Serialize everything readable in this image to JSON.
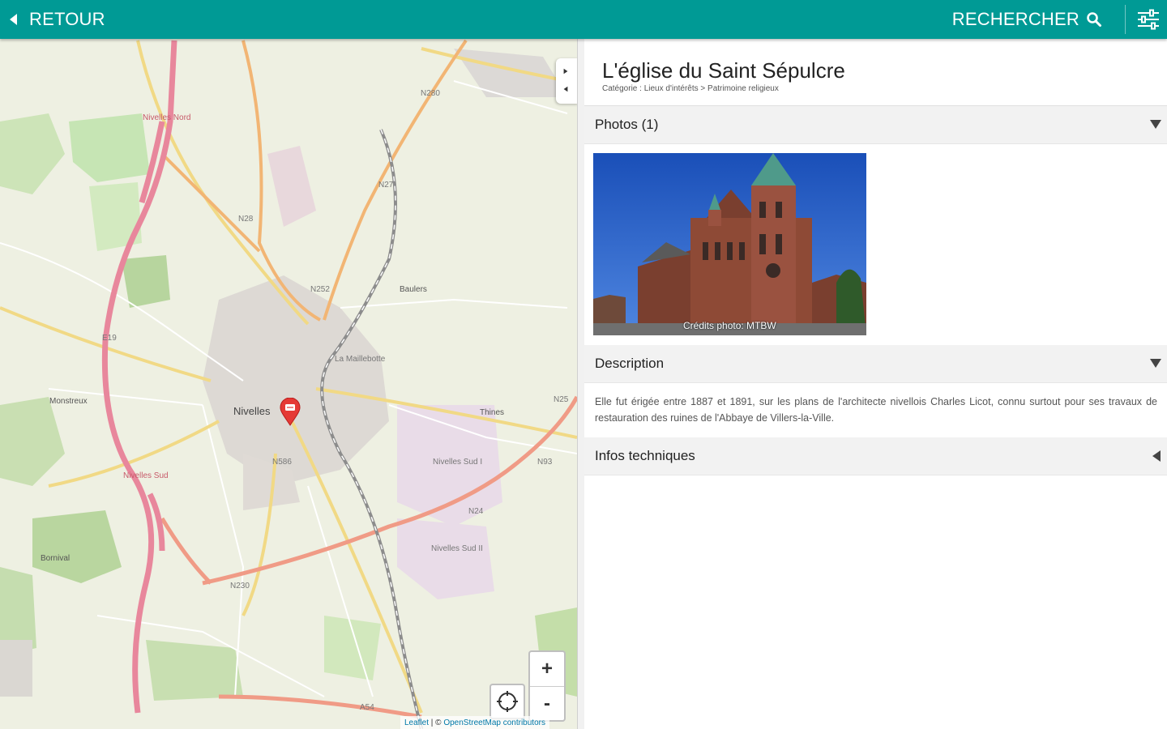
{
  "topbar": {
    "back_label": "RETOUR",
    "search_label": "RECHERCHER",
    "bg_color": "#009a95"
  },
  "map": {
    "labels": {
      "nivelles_nord": "Nivelles Nord",
      "n280": "N280",
      "n27": "N27",
      "n28": "N28",
      "n252": "N252",
      "baulers": "Baulers",
      "e19": "E19",
      "la_maillebotte": "La Maillebotte",
      "monstreux": "Monstreux",
      "nivelles": "Nivelles",
      "thines": "Thines",
      "n25": "N25",
      "n586": "N586",
      "nivelles_sud_i": "Nivelles Sud I",
      "n93": "N93",
      "nivelles_sud": "Nivelles Sud",
      "n24": "N24",
      "nivelles_sud_ii": "Nivelles Sud II",
      "n230": "N230",
      "bornival": "Bornival",
      "a54": "A54"
    },
    "zoom_in": "+",
    "zoom_out": "-",
    "attribution_leaflet": "Leaflet",
    "attribution_sep": " | © ",
    "attribution_osm": "OpenStreetMap contributors"
  },
  "detail": {
    "title": "L'église du Saint Sépulcre",
    "breadcrumb": "Catégorie : Lieux d'intérêts > Patrimoine religieux",
    "photos_label": "Photos (1)",
    "photo_credit": "Crédits photo: MTBW",
    "description_label": "Description",
    "description_text": "Elle fut érigée entre 1887 et 1891, sur les plans de l'architecte nivellois Charles Licot, connu surtout pour ses travaux de restauration des ruines de l'Abbaye de Villers-la-Ville.",
    "tech_label": "Infos techniques"
  },
  "icons": {
    "back": "chevron-left-icon",
    "search": "search-icon",
    "filters": "sliders-icon",
    "marker": "map-marker-icon",
    "locate": "locate-icon"
  }
}
